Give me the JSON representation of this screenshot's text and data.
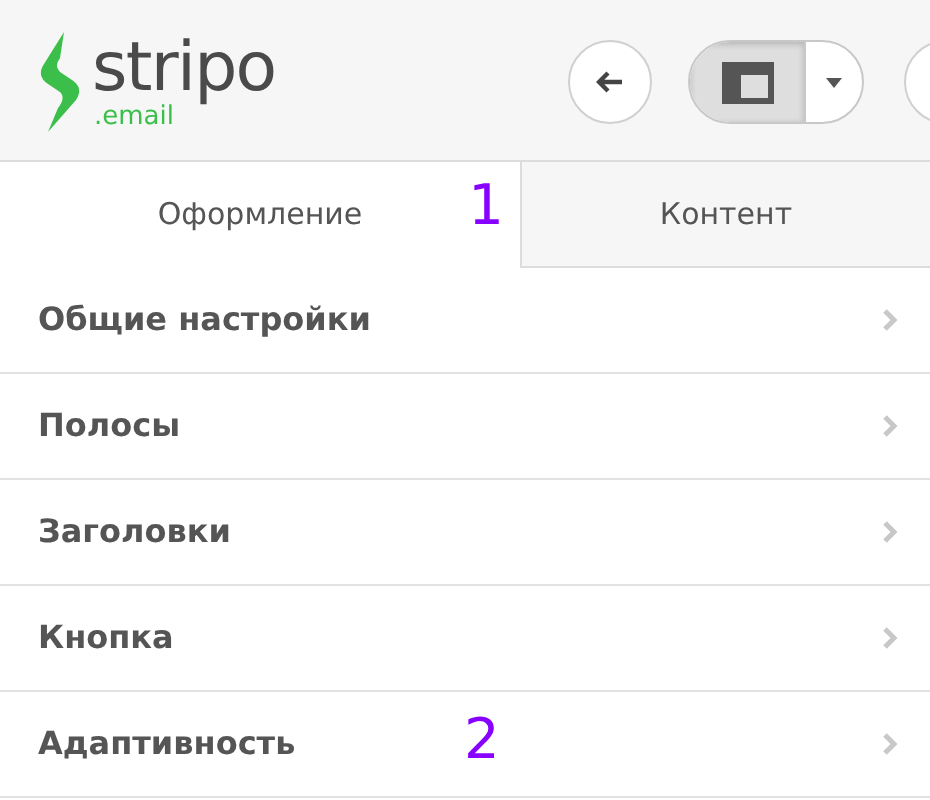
{
  "logo": {
    "name": "stripo",
    "suffix": ".email"
  },
  "toolbar": {
    "layout_button": {
      "pressed": true
    }
  },
  "tabs": [
    {
      "label": "Оформление",
      "selected": true,
      "annotation": "1"
    },
    {
      "label": "Контент",
      "selected": false
    }
  ],
  "settings_items": [
    {
      "label": "Общие настройки"
    },
    {
      "label": "Полосы"
    },
    {
      "label": "Заголовки"
    },
    {
      "label": "Кнопка"
    },
    {
      "label": "Адаптивность",
      "annotation": "2"
    }
  ]
}
